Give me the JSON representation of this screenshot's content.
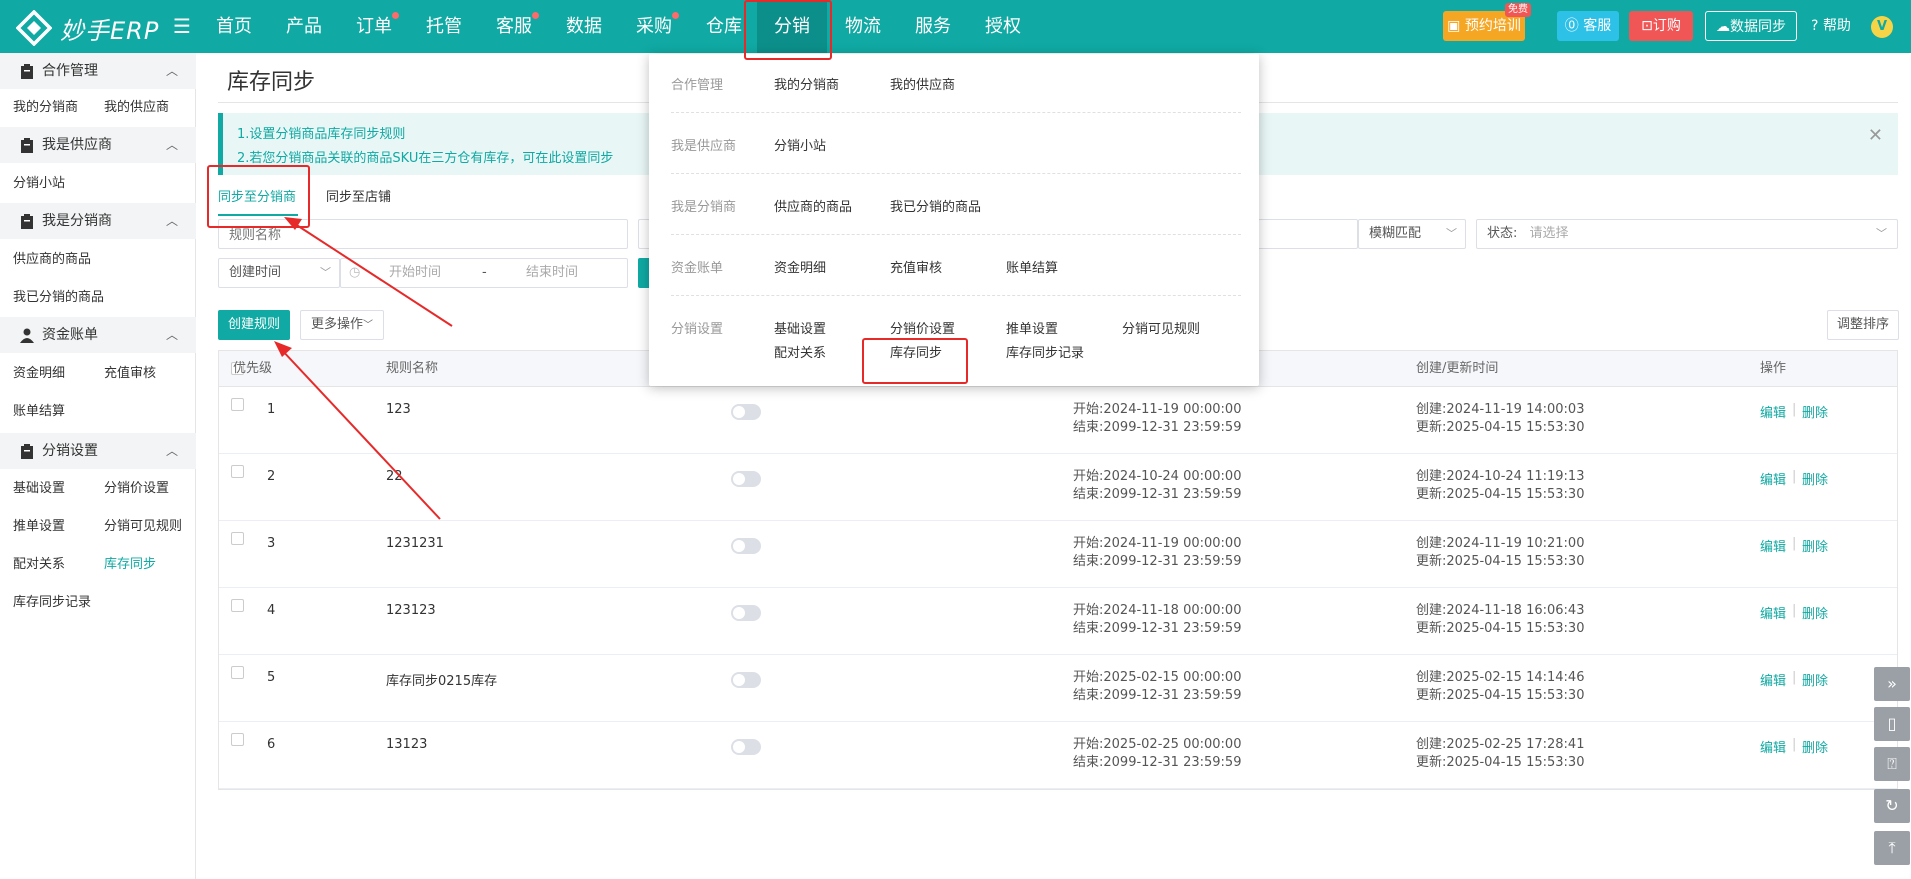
{
  "header": {
    "logo_text": "妙手ERP",
    "nav": [
      {
        "label": "首页",
        "dot": false,
        "active": false
      },
      {
        "label": "产品",
        "dot": false,
        "active": false
      },
      {
        "label": "订单",
        "dot": true,
        "active": false
      },
      {
        "label": "托管",
        "dot": false,
        "active": false
      },
      {
        "label": "客服",
        "dot": true,
        "active": false
      },
      {
        "label": "数据",
        "dot": false,
        "active": false
      },
      {
        "label": "采购",
        "dot": true,
        "active": false
      },
      {
        "label": "仓库",
        "dot": false,
        "active": false
      },
      {
        "label": "分销",
        "dot": false,
        "active": true
      },
      {
        "label": "物流",
        "dot": false,
        "active": false
      },
      {
        "label": "服务",
        "dot": false,
        "active": false
      },
      {
        "label": "授权",
        "dot": false,
        "active": false
      }
    ],
    "training_label": "预约培训",
    "free_badge": "免费",
    "service_label": "客服",
    "order_label": "订购",
    "sync_label": "数据同步",
    "help_label": "帮助",
    "avatar_letter": "V"
  },
  "sidebar": {
    "groups": [
      {
        "label": "合作管理",
        "items": [
          "我的分销商",
          "我的供应商"
        ]
      },
      {
        "label": "我是供应商",
        "items": [
          "分销小站"
        ]
      },
      {
        "label": "我是分销商",
        "items": [
          "供应商的商品",
          "我已分销的商品"
        ]
      },
      {
        "label": "资金账单",
        "items": [
          "资金明细",
          "充值审核",
          "账单结算"
        ]
      },
      {
        "label": "分销设置",
        "items": [
          "基础设置",
          "分销价设置",
          "推单设置",
          "分销可见规则",
          "配对关系",
          "库存同步",
          "库存同步记录"
        ]
      }
    ],
    "active_item": "库存同步"
  },
  "page": {
    "title": "库存同步",
    "notices": [
      "1.设置分销商品库存同步规则",
      "2.若您分销商品关联的商品SKU在三方仓有库存，可在此设置同步"
    ],
    "tabs": [
      "同步至分销商",
      "同步至店铺"
    ],
    "active_tab": "同步至分销商"
  },
  "filters": {
    "rule_name_placeholder": "规则名称",
    "match_mode": "模糊匹配",
    "status_label": "状态:",
    "status_placeholder": "请选择",
    "time_type": "创建时间",
    "start_placeholder": "开始时间",
    "range_separator": "-",
    "end_placeholder": "结束时间"
  },
  "toolbar": {
    "create_label": "创建规则",
    "more_label": "更多操作",
    "sort_label": "调整排序"
  },
  "table": {
    "headers": {
      "priority": "优先级",
      "name": "规则名称",
      "time": "创建/更新时间",
      "action": "操作"
    },
    "start_prefix": "开始:",
    "end_prefix": "结束:",
    "created_prefix": "创建:",
    "updated_prefix": "更新:",
    "edit_label": "编辑",
    "delete_label": "删除",
    "action_sep": "|",
    "rows": [
      {
        "priority": "1",
        "name": "123",
        "start": "2024-11-19 00:00:00",
        "end": "2099-12-31 23:59:59",
        "created": "2024-11-19 14:00:03",
        "updated": "2025-04-15 15:53:30"
      },
      {
        "priority": "2",
        "name": "22",
        "start": "2024-10-24 00:00:00",
        "end": "2099-12-31 23:59:59",
        "created": "2024-10-24 11:19:13",
        "updated": "2025-04-15 15:53:30"
      },
      {
        "priority": "3",
        "name": "1231231",
        "start": "2024-11-19 00:00:00",
        "end": "2099-12-31 23:59:59",
        "created": "2024-11-19 10:21:00",
        "updated": "2025-04-15 15:53:30"
      },
      {
        "priority": "4",
        "name": "123123",
        "start": "2024-11-18 00:00:00",
        "end": "2099-12-31 23:59:59",
        "created": "2024-11-18 16:06:43",
        "updated": "2025-04-15 15:53:30"
      },
      {
        "priority": "5",
        "name": "库存同步0215库存",
        "start": "2025-02-15 00:00:00",
        "end": "2099-12-31 23:59:59",
        "created": "2025-02-15 14:14:46",
        "updated": "2025-04-15 15:53:30"
      },
      {
        "priority": "6",
        "name": "13123",
        "start": "2025-02-25 00:00:00",
        "end": "2099-12-31 23:59:59",
        "created": "2025-02-25 17:28:41",
        "updated": "2025-04-15 15:53:30"
      }
    ]
  },
  "dropdown": {
    "sections": [
      {
        "category": "合作管理",
        "links": [
          "我的分销商",
          "我的供应商"
        ]
      },
      {
        "category": "我是供应商",
        "links": [
          "分销小站"
        ]
      },
      {
        "category": "我是分销商",
        "links": [
          "供应商的商品",
          "我已分销的商品"
        ]
      },
      {
        "category": "资金账单",
        "links": [
          "资金明细",
          "充值审核",
          "账单结算"
        ]
      },
      {
        "category": "分销设置",
        "links": [
          "基础设置",
          "分销价设置",
          "推单设置",
          "分销可见规则",
          "配对关系",
          "库存同步",
          "库存同步记录"
        ]
      }
    ]
  },
  "colors": {
    "brand": "#10a9a3",
    "highlight": "#e62a2a",
    "training": "#f5a623",
    "service": "#2ec1e8",
    "order": "#f05656"
  }
}
